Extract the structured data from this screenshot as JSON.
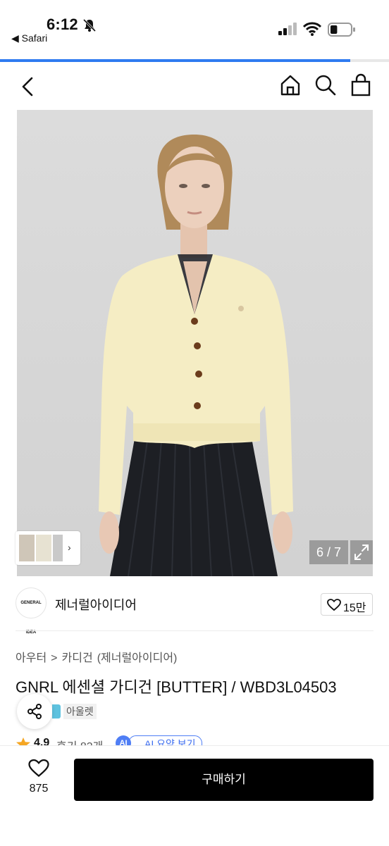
{
  "status_bar": {
    "time": "6:12",
    "back_app": "◀ Safari",
    "battery_level": 0.35
  },
  "page_load_progress": 0.9,
  "product": {
    "image_counter": "6 / 7",
    "brand": {
      "name": "제너럴아이디어",
      "logo_text": "GENERAL IDEA",
      "likes": "15만"
    },
    "breadcrumb": [
      "아우터",
      ">",
      "카디건",
      "(제너럴아이디어)"
    ],
    "title": "GNRL 에센셜 가디건 [BUTTER] / WBD3L04503",
    "tag_outlet": "아울렛",
    "rating": "4.9",
    "reviews": "후기 83개",
    "ai_badge": "AI",
    "ai_summary": "AI 요약 보기"
  },
  "bottom_bar": {
    "wish_count": "875",
    "buy_label": "구매하기"
  },
  "colors": {
    "accent_blue": "#2f7bf0",
    "ai_blue": "#4f7ef5",
    "star": "#f5a623",
    "buy_bg": "#000000"
  },
  "icons": [
    "back-chevron-icon",
    "home-icon",
    "search-icon",
    "bag-icon",
    "share-icon",
    "heart-icon",
    "star-icon",
    "expand-icon",
    "bell-muted-icon",
    "wifi-icon",
    "signal-icon",
    "battery-icon"
  ]
}
